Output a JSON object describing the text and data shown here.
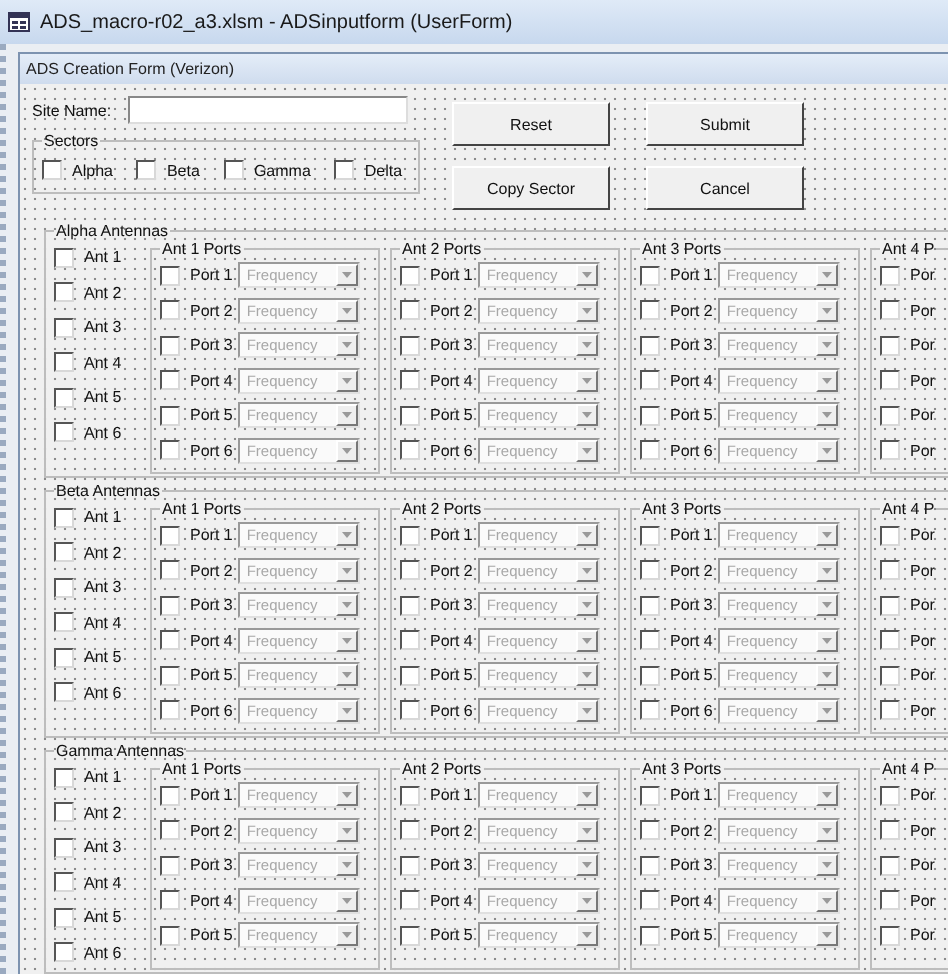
{
  "window": {
    "title": "ADS_macro-r02_a3.xlsm - ADSinputform (UserForm)"
  },
  "form": {
    "caption": "ADS Creation Form (Verizon)",
    "site_name": {
      "label": "Site Name:"
    },
    "sectors": {
      "title": "Sectors",
      "items": [
        {
          "label": "Alpha",
          "checked": false
        },
        {
          "label": "Beta",
          "checked": false
        },
        {
          "label": "Gamma",
          "checked": false
        },
        {
          "label": "Delta",
          "checked": false
        }
      ]
    },
    "buttons": [
      "Reset",
      "Submit",
      "Copy Sector",
      "Cancel"
    ],
    "sections": [
      {
        "title": "Alpha Antennas",
        "antennas": [
          {
            "label": "Ant 1",
            "checked": false
          },
          {
            "label": "Ant 2",
            "checked": false
          },
          {
            "label": "Ant 3",
            "checked": false
          },
          {
            "label": "Ant 4",
            "checked": false
          },
          {
            "label": "Ant 5",
            "checked": false
          },
          {
            "label": "Ant 6",
            "checked": false
          }
        ],
        "port_groups": [
          {
            "title": "Ant 1 Ports",
            "ports": [
              {
                "label": "Port 1",
                "checked": false,
                "value": "Frequency",
                "disabled": true
              },
              {
                "label": "Port 2",
                "checked": false,
                "value": "Frequency",
                "disabled": true
              },
              {
                "label": "Port 3",
                "checked": false,
                "value": "Frequency",
                "disabled": true
              },
              {
                "label": "Port 4",
                "checked": false,
                "value": "Frequency",
                "disabled": true
              },
              {
                "label": "Port 5",
                "checked": false,
                "value": "Frequency",
                "disabled": true
              },
              {
                "label": "Port 6",
                "checked": false,
                "value": "Frequency",
                "disabled": true
              }
            ]
          },
          {
            "title": "Ant 2 Ports",
            "ports": [
              {
                "label": "Port 1",
                "checked": false,
                "value": "Frequency",
                "disabled": true
              },
              {
                "label": "Port 2",
                "checked": false,
                "value": "Frequency",
                "disabled": true
              },
              {
                "label": "Port 3",
                "checked": false,
                "value": "Frequency",
                "disabled": true
              },
              {
                "label": "Port 4",
                "checked": false,
                "value": "Frequency",
                "disabled": true
              },
              {
                "label": "Port 5",
                "checked": false,
                "value": "Frequency",
                "disabled": true
              },
              {
                "label": "Port 6",
                "checked": false,
                "value": "Frequency",
                "disabled": true
              }
            ]
          },
          {
            "title": "Ant 3 Ports",
            "ports": [
              {
                "label": "Port 1",
                "checked": false,
                "value": "Frequency",
                "disabled": true
              },
              {
                "label": "Port 2",
                "checked": false,
                "value": "Frequency",
                "disabled": true
              },
              {
                "label": "Port 3",
                "checked": false,
                "value": "Frequency",
                "disabled": true
              },
              {
                "label": "Port 4",
                "checked": false,
                "value": "Frequency",
                "disabled": true
              },
              {
                "label": "Port 5",
                "checked": false,
                "value": "Frequency",
                "disabled": true
              },
              {
                "label": "Port 6",
                "checked": false,
                "value": "Frequency",
                "disabled": true
              }
            ]
          },
          {
            "title": "Ant 4 P",
            "ports": [
              {
                "label": "Por",
                "checked": false
              },
              {
                "label": "Por",
                "checked": false
              },
              {
                "label": "Por",
                "checked": false
              },
              {
                "label": "Por",
                "checked": false
              },
              {
                "label": "Por",
                "checked": false
              },
              {
                "label": "Por",
                "checked": false
              }
            ]
          }
        ]
      },
      {
        "title": "Beta Antennas",
        "antennas": [
          {
            "label": "Ant 1",
            "checked": false
          },
          {
            "label": "Ant 2",
            "checked": false
          },
          {
            "label": "Ant 3",
            "checked": false
          },
          {
            "label": "Ant 4",
            "checked": false
          },
          {
            "label": "Ant 5",
            "checked": false
          },
          {
            "label": "Ant 6",
            "checked": false
          }
        ],
        "port_groups": [
          {
            "title": "Ant 1 Ports",
            "ports": [
              {
                "label": "Port 1",
                "checked": false,
                "value": "Frequency",
                "disabled": true
              },
              {
                "label": "Port 2",
                "checked": false,
                "value": "Frequency",
                "disabled": true
              },
              {
                "label": "Port 3",
                "checked": false,
                "value": "Frequency",
                "disabled": true
              },
              {
                "label": "Port 4",
                "checked": false,
                "value": "Frequency",
                "disabled": true
              },
              {
                "label": "Port 5",
                "checked": false,
                "value": "Frequency",
                "disabled": true
              },
              {
                "label": "Port 6",
                "checked": false,
                "value": "Frequency",
                "disabled": true
              }
            ]
          },
          {
            "title": "Ant 2 Ports",
            "ports": [
              {
                "label": "Port 1",
                "checked": false,
                "value": "Frequency",
                "disabled": true
              },
              {
                "label": "Port 2",
                "checked": false,
                "value": "Frequency",
                "disabled": true
              },
              {
                "label": "Port 3",
                "checked": false,
                "value": "Frequency",
                "disabled": true
              },
              {
                "label": "Port 4",
                "checked": false,
                "value": "Frequency",
                "disabled": true
              },
              {
                "label": "Port 5",
                "checked": false,
                "value": "Frequency",
                "disabled": true
              },
              {
                "label": "Port 6",
                "checked": false,
                "value": "Frequency",
                "disabled": true
              }
            ]
          },
          {
            "title": "Ant 3 Ports",
            "ports": [
              {
                "label": "Port 1",
                "checked": false,
                "value": "Frequency",
                "disabled": true
              },
              {
                "label": "Port 2",
                "checked": false,
                "value": "Frequency",
                "disabled": true
              },
              {
                "label": "Port 3",
                "checked": false,
                "value": "Frequency",
                "disabled": true
              },
              {
                "label": "Port 4",
                "checked": false,
                "value": "Frequency",
                "disabled": true
              },
              {
                "label": "Port 5",
                "checked": false,
                "value": "Frequency",
                "disabled": true
              },
              {
                "label": "Port 6",
                "checked": false,
                "value": "Frequency",
                "disabled": true
              }
            ]
          },
          {
            "title": "Ant 4 P",
            "ports": [
              {
                "label": "Por",
                "checked": false
              },
              {
                "label": "Por",
                "checked": false
              },
              {
                "label": "Por",
                "checked": false
              },
              {
                "label": "Por",
                "checked": false
              },
              {
                "label": "Por",
                "checked": false
              },
              {
                "label": "Por",
                "checked": false
              }
            ]
          }
        ]
      },
      {
        "title": "Gamma Antennas",
        "antennas": [
          {
            "label": "Ant 1",
            "checked": false
          },
          {
            "label": "Ant 2",
            "checked": false
          },
          {
            "label": "Ant 3",
            "checked": false
          },
          {
            "label": "Ant 4",
            "checked": false
          },
          {
            "label": "Ant 5",
            "checked": false
          },
          {
            "label": "Ant 6",
            "checked": false
          }
        ],
        "port_groups": [
          {
            "title": "Ant 1 Ports",
            "ports": [
              {
                "label": "Port 1",
                "checked": false,
                "value": "Frequency",
                "disabled": true
              },
              {
                "label": "Port 2",
                "checked": false,
                "value": "Frequency",
                "disabled": true
              },
              {
                "label": "Port 3",
                "checked": false,
                "value": "Frequency",
                "disabled": true
              },
              {
                "label": "Port 4",
                "checked": false,
                "value": "Frequency",
                "disabled": true
              },
              {
                "label": "Port 5",
                "checked": false,
                "value": "Frequency",
                "disabled": true
              }
            ]
          },
          {
            "title": "Ant 2 Ports",
            "ports": [
              {
                "label": "Port 1",
                "checked": false,
                "value": "Frequency",
                "disabled": true
              },
              {
                "label": "Port 2",
                "checked": false,
                "value": "Frequency",
                "disabled": true
              },
              {
                "label": "Port 3",
                "checked": false,
                "value": "Frequency",
                "disabled": true
              },
              {
                "label": "Port 4",
                "checked": false,
                "value": "Frequency",
                "disabled": true
              },
              {
                "label": "Port 5",
                "checked": false,
                "value": "Frequency",
                "disabled": true
              }
            ]
          },
          {
            "title": "Ant 3 Ports",
            "ports": [
              {
                "label": "Port 1",
                "checked": false,
                "value": "Frequency",
                "disabled": true
              },
              {
                "label": "Port 2",
                "checked": false,
                "value": "Frequency",
                "disabled": true
              },
              {
                "label": "Port 3",
                "checked": false,
                "value": "Frequency",
                "disabled": true
              },
              {
                "label": "Port 4",
                "checked": false,
                "value": "Frequency",
                "disabled": true
              },
              {
                "label": "Port 5",
                "checked": false,
                "value": "Frequency",
                "disabled": true
              }
            ]
          },
          {
            "title": "Ant 4 P",
            "ports": [
              {
                "label": "Por",
                "checked": false
              },
              {
                "label": "Por",
                "checked": false
              },
              {
                "label": "Por",
                "checked": false
              },
              {
                "label": "Por",
                "checked": false
              },
              {
                "label": "Por",
                "checked": false
              }
            ]
          }
        ]
      }
    ]
  }
}
